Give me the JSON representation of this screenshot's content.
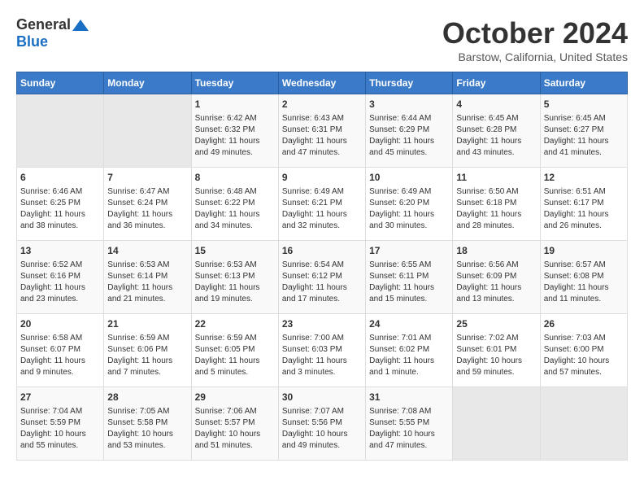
{
  "logo": {
    "general": "General",
    "blue": "Blue"
  },
  "title": "October 2024",
  "location": "Barstow, California, United States",
  "days_of_week": [
    "Sunday",
    "Monday",
    "Tuesday",
    "Wednesday",
    "Thursday",
    "Friday",
    "Saturday"
  ],
  "weeks": [
    [
      {
        "day": "",
        "empty": true
      },
      {
        "day": "",
        "empty": true
      },
      {
        "day": "1",
        "sunrise": "6:42 AM",
        "sunset": "6:32 PM",
        "daylight": "11 hours and 49 minutes."
      },
      {
        "day": "2",
        "sunrise": "6:43 AM",
        "sunset": "6:31 PM",
        "daylight": "11 hours and 47 minutes."
      },
      {
        "day": "3",
        "sunrise": "6:44 AM",
        "sunset": "6:29 PM",
        "daylight": "11 hours and 45 minutes."
      },
      {
        "day": "4",
        "sunrise": "6:45 AM",
        "sunset": "6:28 PM",
        "daylight": "11 hours and 43 minutes."
      },
      {
        "day": "5",
        "sunrise": "6:45 AM",
        "sunset": "6:27 PM",
        "daylight": "11 hours and 41 minutes."
      }
    ],
    [
      {
        "day": "6",
        "sunrise": "6:46 AM",
        "sunset": "6:25 PM",
        "daylight": "11 hours and 38 minutes."
      },
      {
        "day": "7",
        "sunrise": "6:47 AM",
        "sunset": "6:24 PM",
        "daylight": "11 hours and 36 minutes."
      },
      {
        "day": "8",
        "sunrise": "6:48 AM",
        "sunset": "6:22 PM",
        "daylight": "11 hours and 34 minutes."
      },
      {
        "day": "9",
        "sunrise": "6:49 AM",
        "sunset": "6:21 PM",
        "daylight": "11 hours and 32 minutes."
      },
      {
        "day": "10",
        "sunrise": "6:49 AM",
        "sunset": "6:20 PM",
        "daylight": "11 hours and 30 minutes."
      },
      {
        "day": "11",
        "sunrise": "6:50 AM",
        "sunset": "6:18 PM",
        "daylight": "11 hours and 28 minutes."
      },
      {
        "day": "12",
        "sunrise": "6:51 AM",
        "sunset": "6:17 PM",
        "daylight": "11 hours and 26 minutes."
      }
    ],
    [
      {
        "day": "13",
        "sunrise": "6:52 AM",
        "sunset": "6:16 PM",
        "daylight": "11 hours and 23 minutes."
      },
      {
        "day": "14",
        "sunrise": "6:53 AM",
        "sunset": "6:14 PM",
        "daylight": "11 hours and 21 minutes."
      },
      {
        "day": "15",
        "sunrise": "6:53 AM",
        "sunset": "6:13 PM",
        "daylight": "11 hours and 19 minutes."
      },
      {
        "day": "16",
        "sunrise": "6:54 AM",
        "sunset": "6:12 PM",
        "daylight": "11 hours and 17 minutes."
      },
      {
        "day": "17",
        "sunrise": "6:55 AM",
        "sunset": "6:11 PM",
        "daylight": "11 hours and 15 minutes."
      },
      {
        "day": "18",
        "sunrise": "6:56 AM",
        "sunset": "6:09 PM",
        "daylight": "11 hours and 13 minutes."
      },
      {
        "day": "19",
        "sunrise": "6:57 AM",
        "sunset": "6:08 PM",
        "daylight": "11 hours and 11 minutes."
      }
    ],
    [
      {
        "day": "20",
        "sunrise": "6:58 AM",
        "sunset": "6:07 PM",
        "daylight": "11 hours and 9 minutes."
      },
      {
        "day": "21",
        "sunrise": "6:59 AM",
        "sunset": "6:06 PM",
        "daylight": "11 hours and 7 minutes."
      },
      {
        "day": "22",
        "sunrise": "6:59 AM",
        "sunset": "6:05 PM",
        "daylight": "11 hours and 5 minutes."
      },
      {
        "day": "23",
        "sunrise": "7:00 AM",
        "sunset": "6:03 PM",
        "daylight": "11 hours and 3 minutes."
      },
      {
        "day": "24",
        "sunrise": "7:01 AM",
        "sunset": "6:02 PM",
        "daylight": "11 hours and 1 minute."
      },
      {
        "day": "25",
        "sunrise": "7:02 AM",
        "sunset": "6:01 PM",
        "daylight": "10 hours and 59 minutes."
      },
      {
        "day": "26",
        "sunrise": "7:03 AM",
        "sunset": "6:00 PM",
        "daylight": "10 hours and 57 minutes."
      }
    ],
    [
      {
        "day": "27",
        "sunrise": "7:04 AM",
        "sunset": "5:59 PM",
        "daylight": "10 hours and 55 minutes."
      },
      {
        "day": "28",
        "sunrise": "7:05 AM",
        "sunset": "5:58 PM",
        "daylight": "10 hours and 53 minutes."
      },
      {
        "day": "29",
        "sunrise": "7:06 AM",
        "sunset": "5:57 PM",
        "daylight": "10 hours and 51 minutes."
      },
      {
        "day": "30",
        "sunrise": "7:07 AM",
        "sunset": "5:56 PM",
        "daylight": "10 hours and 49 minutes."
      },
      {
        "day": "31",
        "sunrise": "7:08 AM",
        "sunset": "5:55 PM",
        "daylight": "10 hours and 47 minutes."
      },
      {
        "day": "",
        "empty": true
      },
      {
        "day": "",
        "empty": true
      }
    ]
  ]
}
